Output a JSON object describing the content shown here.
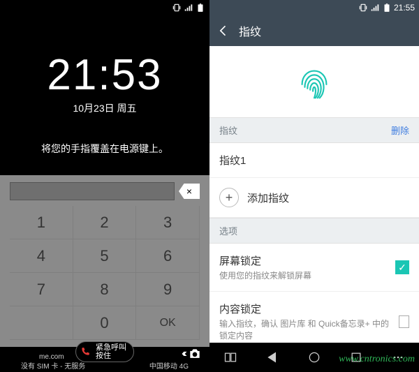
{
  "left": {
    "status_time": "",
    "clock_time": "21:53",
    "clock_date": "10月23日 周五",
    "finger_msg": "将您的手指覆盖在电源键上。",
    "keypad": {
      "k1": "1",
      "k2": "2",
      "k3": "3",
      "k4": "4",
      "k5": "5",
      "k6": "6",
      "k7": "7",
      "k8": "8",
      "k9": "9",
      "k0": "0",
      "ok": "OK"
    },
    "backspace_symbol": "×",
    "emergency_prefix": "me.com",
    "emergency_line1": "紧急呼叫",
    "emergency_line2": "按住",
    "no_sim": "没有 SIM 卡 - 无服务",
    "carrier": "中国移动 4G"
  },
  "right": {
    "status_time": "21:55",
    "title": "指纹",
    "section_fp": "指纹",
    "delete": "删除",
    "fp_item1": "指纹1",
    "add_fp": "添加指纹",
    "section_options": "选项",
    "screen_lock_title": "屏幕锁定",
    "screen_lock_sub": "使用您的指纹来解锁屏幕",
    "content_lock_title": "内容锁定",
    "content_lock_sub": "输入指纹，确认 图片库 和 Quick备忘录+ 中的锁定内容"
  },
  "watermark": "www.cntronics.com"
}
